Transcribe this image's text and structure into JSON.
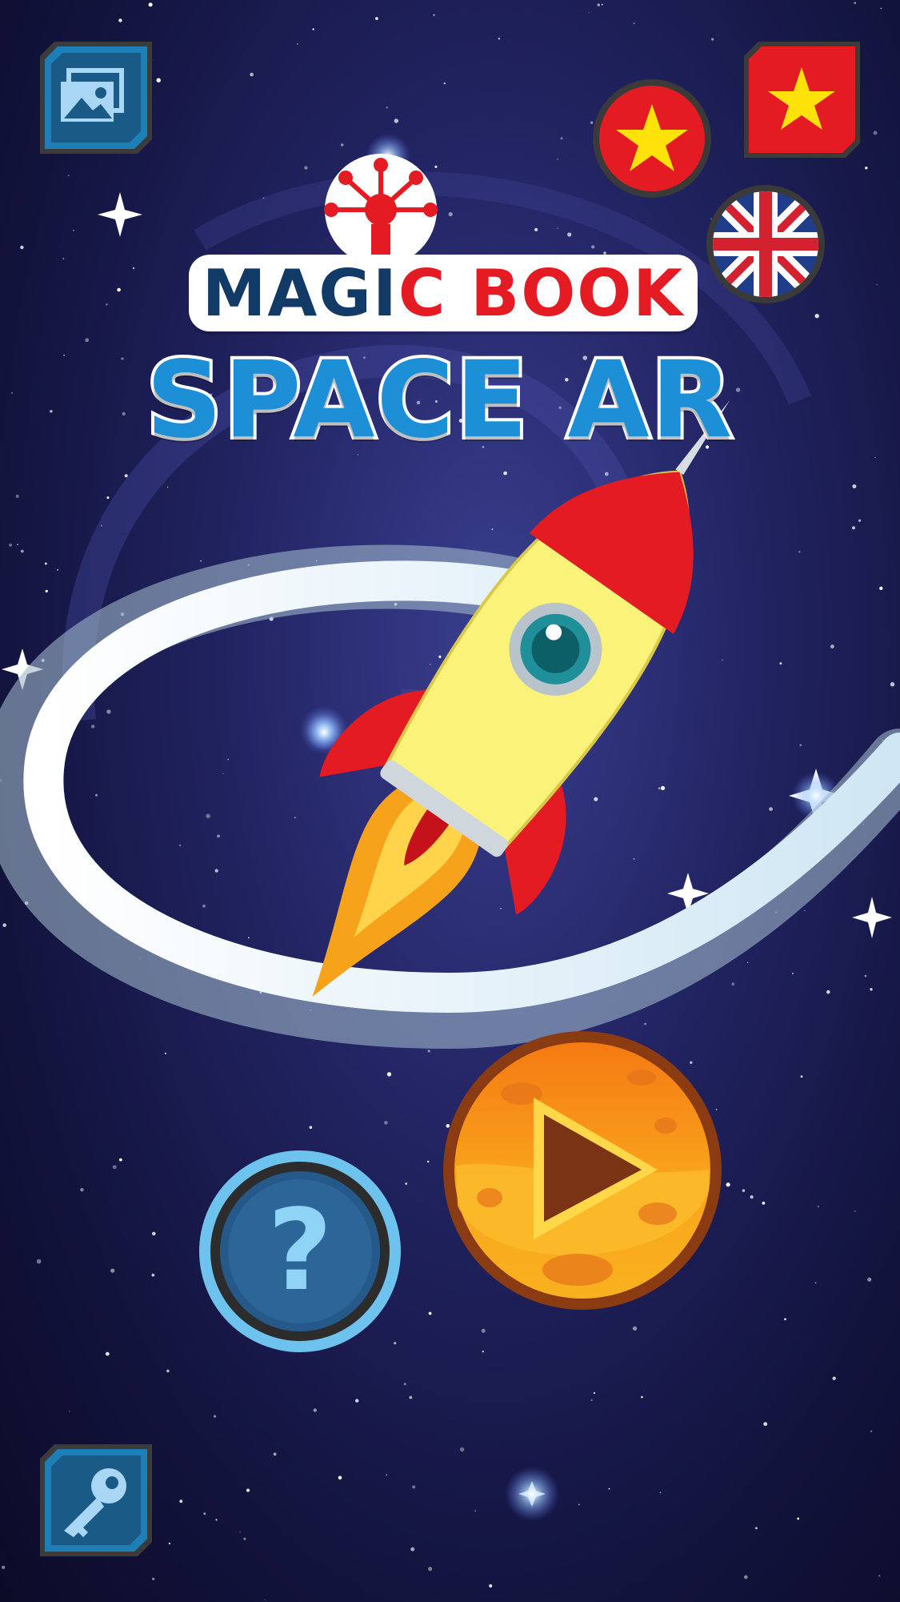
{
  "app": {
    "title_line1_part1": "MAGI",
    "title_line1_part2": "C BOOK",
    "title_line2": "SPACE AR"
  },
  "buttons": {
    "gallery": "gallery",
    "language_vietnamese_round": "vietnamese",
    "language_vietnamese_square": "vietnamese",
    "language_english": "english",
    "play": "play",
    "help": "?",
    "key": "key"
  },
  "colors": {
    "background": "#16173f",
    "title_dark": "#123a66",
    "title_accent": "#e41b23",
    "title_blue": "#1d8fd6",
    "play_orange": "#f39a1d",
    "help_blue": "#2a5f8e"
  }
}
